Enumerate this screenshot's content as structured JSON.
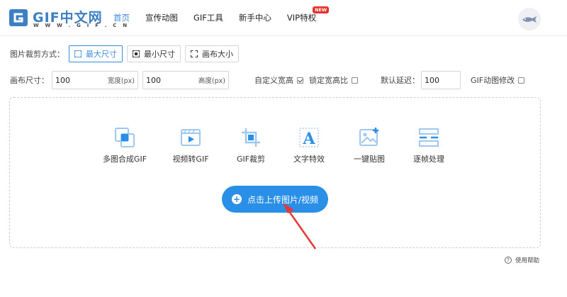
{
  "header": {
    "logo_text": "GIF中文网",
    "logo_sub": "W W W . G I F . C N",
    "nav": [
      {
        "label": "首页",
        "active": true
      },
      {
        "label": "宣传动图",
        "active": false
      },
      {
        "label": "GIF工具",
        "active": false
      },
      {
        "label": "新手中心",
        "active": false
      },
      {
        "label": "VIP特权",
        "active": false,
        "badge": "NEW"
      }
    ]
  },
  "crop_mode": {
    "label": "图片裁剪方式：",
    "options": [
      {
        "label": "最大尺寸",
        "active": true
      },
      {
        "label": "最小尺寸",
        "active": false
      },
      {
        "label": "画布大小",
        "active": false
      }
    ]
  },
  "canvas": {
    "label": "画布尺寸：",
    "width_value": "100",
    "width_unit": "宽度(px)",
    "height_value": "100",
    "height_unit": "高度(px)",
    "custom_label": "自定义宽高",
    "custom_checked": true,
    "lock_label": "锁定宽高比",
    "lock_checked": false,
    "delay_label": "默认延迟：",
    "delay_value": "100",
    "gif_edit_label": "GIF动图修改",
    "gif_edit_checked": false
  },
  "tools": [
    {
      "label": "多图合成GIF",
      "icon": "merge-images-icon"
    },
    {
      "label": "视频转GIF",
      "icon": "video-play-icon"
    },
    {
      "label": "GIF裁剪",
      "icon": "crop-icon"
    },
    {
      "label": "文字特效",
      "icon": "text-a-icon"
    },
    {
      "label": "一键贴图",
      "icon": "image-sticker-icon"
    },
    {
      "label": "逐帧处理",
      "icon": "frames-icon"
    }
  ],
  "upload": {
    "label": "点击上传图片/视频"
  },
  "help": {
    "label": "使用帮助"
  },
  "colors": {
    "accent": "#2a8fe6",
    "brand": "#3d7fc4",
    "badge": "#e8312b",
    "arrow": "#e53935"
  }
}
